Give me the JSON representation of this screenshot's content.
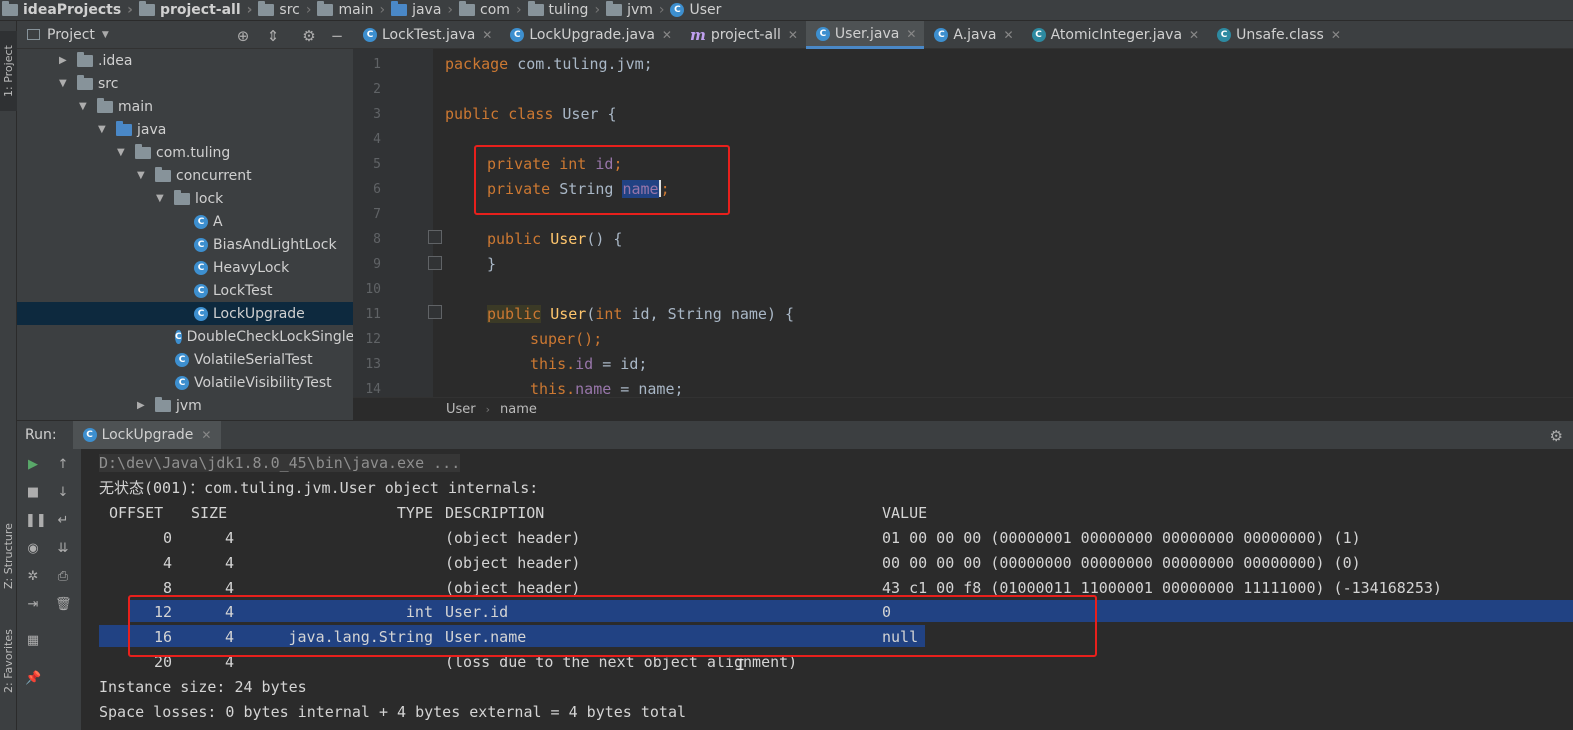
{
  "breadcrumbs": [
    "ideaProjects",
    "project-all",
    "src",
    "main",
    "java",
    "com",
    "tuling",
    "jvm",
    "User"
  ],
  "left_strip": {
    "project_tab": "1: Project",
    "structure_tab": "Z: Structure",
    "favorites_tab": "2: Favorites"
  },
  "project_panel": {
    "title": "Project"
  },
  "tree": [
    {
      "label": ".idea",
      "type": "folder",
      "arrow": "▶"
    },
    {
      "label": "src",
      "type": "folder",
      "arrow": "▼"
    },
    {
      "label": "main",
      "type": "folder",
      "arrow": "▼"
    },
    {
      "label": "java",
      "type": "folder-blue",
      "arrow": "▼"
    },
    {
      "label": "com.tuling",
      "type": "package",
      "arrow": "▼"
    },
    {
      "label": "concurrent",
      "type": "package",
      "arrow": "▼"
    },
    {
      "label": "lock",
      "type": "package",
      "arrow": "▼"
    },
    {
      "label": "A",
      "type": "class"
    },
    {
      "label": "BiasAndLightLock",
      "type": "class"
    },
    {
      "label": "HeavyLock",
      "type": "class"
    },
    {
      "label": "LockTest",
      "type": "class"
    },
    {
      "label": "LockUpgrade",
      "type": "class",
      "selected": true
    },
    {
      "label": "DoubleCheckLockSinglet",
      "type": "class"
    },
    {
      "label": "VolatileSerialTest",
      "type": "class"
    },
    {
      "label": "VolatileVisibilityTest",
      "type": "class"
    },
    {
      "label": "jvm",
      "type": "package",
      "arrow": "▶"
    }
  ],
  "editor_tabs": [
    {
      "label": "LockTest.java",
      "icon": "class"
    },
    {
      "label": "LockUpgrade.java",
      "icon": "class"
    },
    {
      "label": "project-all",
      "icon": "m"
    },
    {
      "label": "User.java",
      "icon": "class",
      "active": true
    },
    {
      "label": "A.java",
      "icon": "class"
    },
    {
      "label": "AtomicInteger.java",
      "icon": "lib"
    },
    {
      "label": "Unsafe.class",
      "icon": "lib"
    }
  ],
  "code": {
    "line_numbers": [
      "1",
      "2",
      "3",
      "4",
      "5",
      "6",
      "7",
      "8",
      "9",
      "10",
      "11",
      "12",
      "13",
      "14"
    ],
    "l1_kw": "package",
    "l1_rest": " com.tuling.jvm;",
    "l3_kw": "public class",
    "l3_rest": " User {",
    "l5_kw": "private int",
    "l5_fld": " id",
    "l5_end": ";",
    "l6_kw": "private",
    "l6_type": " String ",
    "l6_fld": "name",
    "l6_end": ";",
    "l8_kw": "public",
    "l8_name": " User",
    "l8_end": "() {",
    "l9": "}",
    "l11_kw": "public",
    "l11_name": " User",
    "l11_p1": "(",
    "l11_int": "int",
    "l11_p2": " id, String name) {",
    "l12": "super();",
    "l13_kw": "this.",
    "l13_fld": "id",
    "l13_end": " = id;",
    "l14_kw": "this.",
    "l14_fld": "name",
    "l14_end": " = name;"
  },
  "editor_breadcrumb": [
    "User",
    "name"
  ],
  "run": {
    "label": "Run:",
    "tab": "LockUpgrade",
    "cmd": "D:\\dev\\Java\\jdk1.8.0_45\\bin\\java.exe ...",
    "title": "无状态(001)：com.tuling.jvm.User object internals:",
    "headers": {
      "offset": "OFFSET",
      "size": "SIZE",
      "type": "TYPE",
      "desc": "DESCRIPTION",
      "value": "VALUE"
    },
    "rows": [
      {
        "offset": "0",
        "size": "4",
        "type": "",
        "desc": "(object header)",
        "value": "01 00 00 00 (00000001 00000000 00000000 00000000) (1)"
      },
      {
        "offset": "4",
        "size": "4",
        "type": "",
        "desc": "(object header)",
        "value": "00 00 00 00 (00000000 00000000 00000000 00000000) (0)"
      },
      {
        "offset": "8",
        "size": "4",
        "type": "",
        "desc": "(object header)",
        "value": "43 c1 00 f8 (01000011 11000001 00000000 11111000) (-134168253)"
      },
      {
        "offset": "12",
        "size": "4",
        "type": "int",
        "desc": "User.id",
        "value": "0"
      },
      {
        "offset": "16",
        "size": "4",
        "type": "java.lang.String",
        "desc": "User.name",
        "value": "null"
      },
      {
        "offset": "20",
        "size": "4",
        "type": "",
        "desc": "(loss due to the next object alignment)",
        "value": ""
      }
    ],
    "instance_size": "Instance size: 24 bytes",
    "space_losses": "Space losses: 0 bytes internal + 4 bytes external = 4 bytes total"
  },
  "colors": {
    "highlight_box": "#e8201c",
    "selection": "#214283",
    "keyword": "#cc7832",
    "field": "#9876aa"
  }
}
